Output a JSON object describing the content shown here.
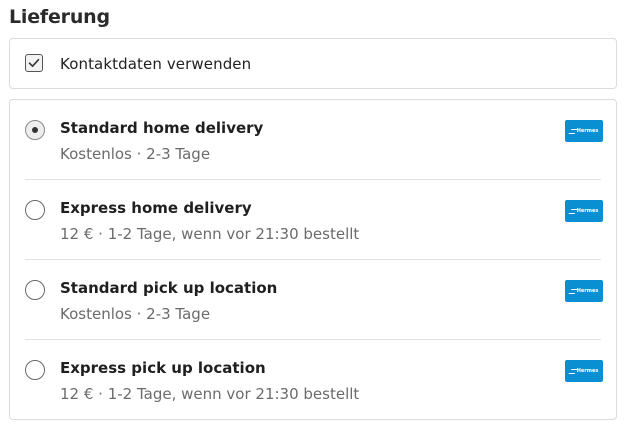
{
  "section": {
    "title": "Lieferung"
  },
  "contact": {
    "label": "Kontaktdaten verwenden",
    "checked": true
  },
  "options": [
    {
      "title": "Standard home delivery",
      "subtitle": "Kostenlos · 2-3 Tage",
      "selected": true,
      "carrier": "Hermes"
    },
    {
      "title": "Express home delivery",
      "subtitle": "12 € · 1-2 Tage, wenn vor 21:30 bestellt",
      "selected": false,
      "carrier": "Hermes"
    },
    {
      "title": "Standard pick up location",
      "subtitle": "Kostenlos · 2-3 Tage",
      "selected": false,
      "carrier": "Hermes"
    },
    {
      "title": "Express pick up location",
      "subtitle": "12 € · 1-2 Tage, wenn vor 21:30 bestellt",
      "selected": false,
      "carrier": "Hermes"
    }
  ],
  "colors": {
    "carrier_brand": "#0a8fd2",
    "border": "#dcdcdc",
    "secondary_text": "#6b6b6b"
  },
  "icons": {
    "checkbox": "checkmark-icon",
    "carrier": "hermes-logo-icon"
  }
}
